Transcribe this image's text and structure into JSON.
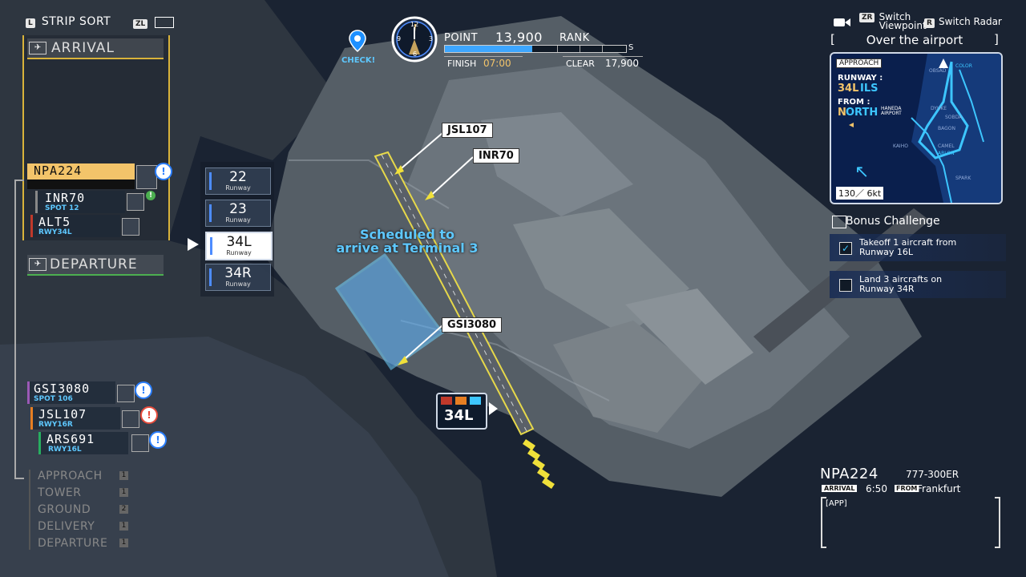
{
  "hud": {
    "strip_sort_key": "L",
    "strip_sort_label": "STRIP SORT",
    "zl_key": "ZL",
    "check_label": "CHECK!",
    "point_label": "POINT",
    "point_value": "13,900",
    "rank_label": "RANK",
    "rank_letter": "S",
    "finish_label": "FINISH",
    "finish_value": "07:00",
    "clear_label": "CLEAR",
    "clear_value": "17,900",
    "clock_numbers": [
      "12",
      "3",
      "6",
      "9"
    ],
    "switch_viewpoint_key": "ZR",
    "switch_viewpoint_label": "Switch\nViewpoint",
    "switch_radar_key": "R",
    "switch_radar_label": "Switch Radar"
  },
  "left_panel": {
    "arrival_header": "ARRIVAL",
    "departure_header": "DEPARTURE",
    "arrival_strips": [
      {
        "callsign": "NPA224",
        "sub": ""
      },
      {
        "callsign": "INR70",
        "sub": "SPOT 12"
      },
      {
        "callsign": "ALT5",
        "sub": "RWY34L"
      }
    ],
    "departure_strips": [
      {
        "callsign": "GSI3080",
        "sub": "SPOT 106"
      },
      {
        "callsign": "JSL107",
        "sub": "RWY16R"
      },
      {
        "callsign": "ARS691",
        "sub": "RWY16L"
      }
    ],
    "categories": [
      {
        "label": "APPROACH",
        "count": "1"
      },
      {
        "label": "TOWER",
        "count": "1"
      },
      {
        "label": "GROUND",
        "count": "2"
      },
      {
        "label": "DELIVERY",
        "count": "1"
      },
      {
        "label": "DEPARTURE",
        "count": "1"
      }
    ]
  },
  "runway_menu": {
    "options": [
      {
        "name": "22",
        "sub": "Runway"
      },
      {
        "name": "23",
        "sub": "Runway"
      },
      {
        "name": "34L",
        "sub": "Runway"
      },
      {
        "name": "34R",
        "sub": "Runway"
      }
    ],
    "selected": "34L"
  },
  "map": {
    "callouts": [
      "JSL107",
      "INR70",
      "GSI3080"
    ],
    "scheduled_text_line1": "Scheduled to",
    "scheduled_text_line2": "arrive at Terminal 3",
    "runway_tag": "34L"
  },
  "radar": {
    "title": "Over the airport",
    "bracket_left": "[",
    "bracket_right": "]",
    "mode": "APPROACH",
    "runway_label": "RUNWAY :",
    "runway_value_a": "34L",
    "runway_value_b": "ILS",
    "from_label": "FROM :",
    "from_value_a": "N",
    "from_value_b": "ORTH",
    "wind": "130／ 6kt",
    "map_labels": [
      "COLOR",
      "OBSAD",
      "HANEDA\nAIRPORT",
      "DYUKE",
      "SOBDA",
      "BAGON",
      "KAIHO",
      "CAMEL",
      "ARLON",
      "SPARK"
    ]
  },
  "bonus": {
    "title": "Bonus Challenge",
    "items": [
      {
        "text": "Takeoff 1 aircraft from\nRunway 16L",
        "checked": true
      },
      {
        "text": "Land 3 aircrafts on\nRunway 34R",
        "checked": false
      }
    ]
  },
  "info": {
    "callsign": "NPA224",
    "aircraft": "777-300ER",
    "type_tag": "ARRIVAL",
    "time": "6:50",
    "from_tag": "FROM",
    "origin": "Frankfurt",
    "log": "[APP]"
  },
  "colors": {
    "accent_blue": "#4d8cff",
    "arrival_gold": "#d9b33a",
    "cyan": "#5ec8ff",
    "selected_strip": "#f3c46a"
  }
}
